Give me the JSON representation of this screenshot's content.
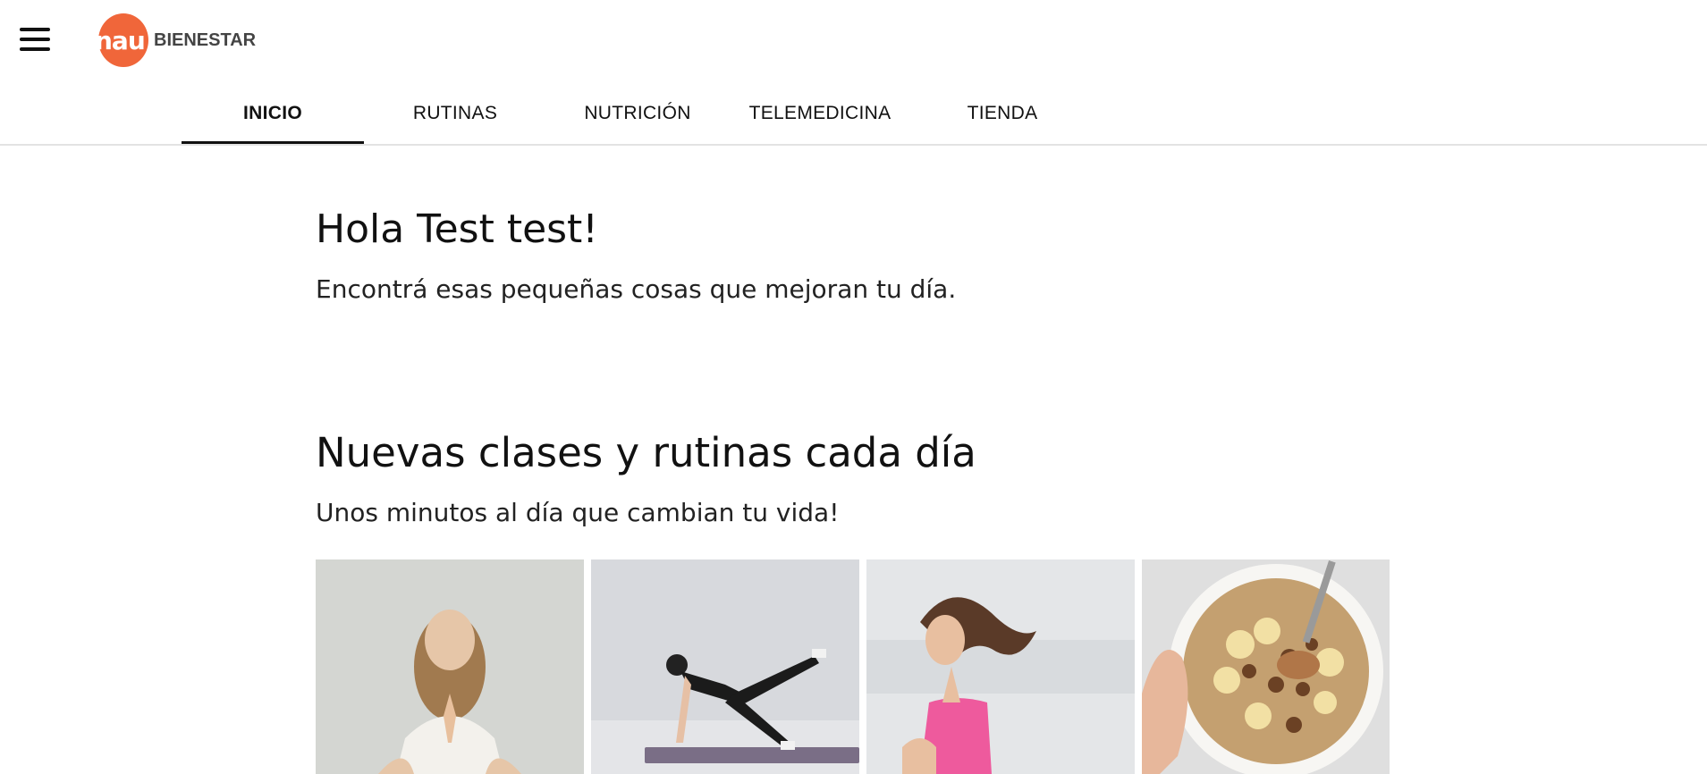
{
  "header": {
    "menu_icon": "hamburger-menu-icon",
    "logo": {
      "mark": "nau",
      "word": "BIENESTAR",
      "mark_color": "#f0663a",
      "word_color": "#444444"
    }
  },
  "tabs": [
    {
      "label": "INICIO",
      "active": true
    },
    {
      "label": "RUTINAS",
      "active": false
    },
    {
      "label": "NUTRICIÓN",
      "active": false
    },
    {
      "label": "TELEMEDICINA",
      "active": false
    },
    {
      "label": "TIENDA",
      "active": false
    }
  ],
  "greeting": {
    "title": "Hola Test test!",
    "subtitle": "Encontrá esas pequeñas cosas que mejoran tu día."
  },
  "classes": {
    "title": "Nuevas clases y rutinas cada día",
    "subtitle": "Unos minutos al día que cambian tu vida!",
    "cards": [
      {
        "image": "meditation-photo"
      },
      {
        "image": "workout-photo"
      },
      {
        "image": "running-photo"
      },
      {
        "image": "oatmeal-bowl-photo"
      }
    ]
  }
}
